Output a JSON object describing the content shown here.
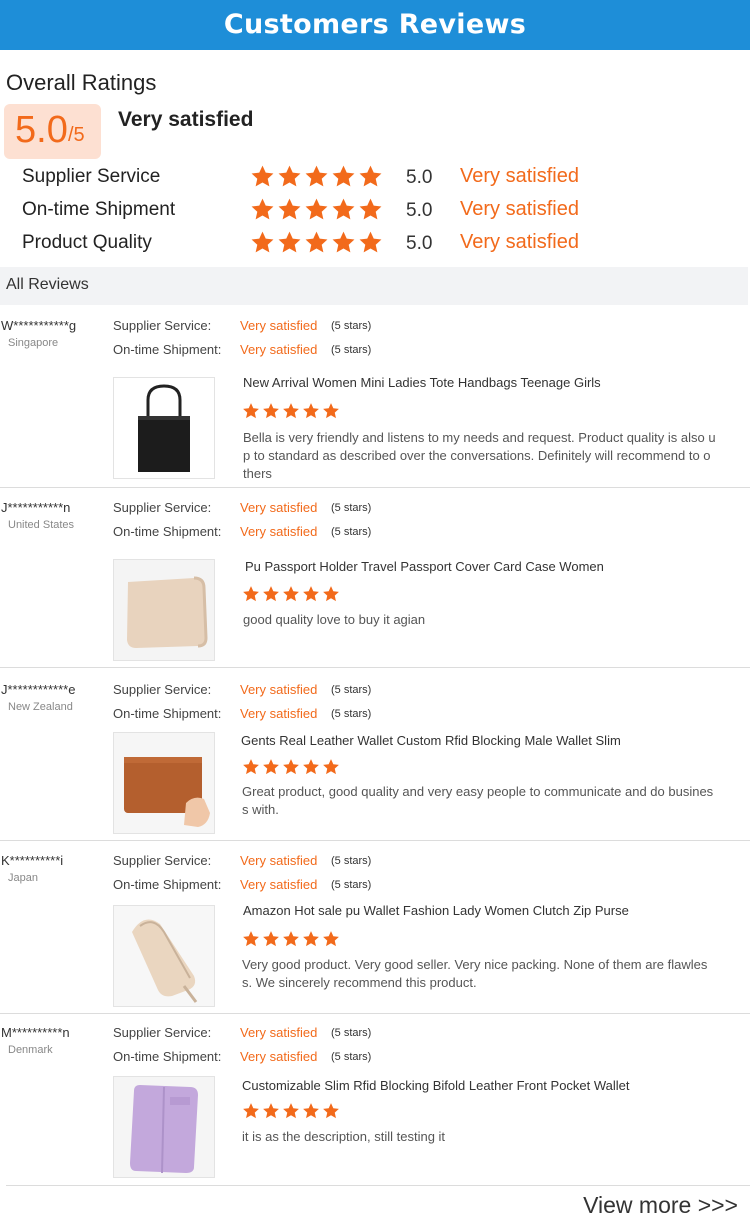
{
  "header": {
    "title": "Customers Reviews"
  },
  "overall": {
    "label": "Overall Ratings",
    "score": "5.0",
    "score_suffix": "/5",
    "text": "Very satisfied",
    "colors": {
      "accent": "#f26a1b",
      "score_bg": "#fde0d2",
      "banner": "#1e8ed8"
    }
  },
  "ratings": [
    {
      "label": "Supplier Service",
      "stars": 5,
      "score": "5.0",
      "text": "Very satisfied"
    },
    {
      "label": "On-time Shipment",
      "stars": 5,
      "score": "5.0",
      "text": "Very satisfied"
    },
    {
      "label": "Product Quality",
      "stars": 5,
      "score": "5.0",
      "text": "Very satisfied"
    }
  ],
  "all_reviews_label": "All Reviews",
  "reviews": [
    {
      "user": "W***********g",
      "country": "Singapore",
      "supplier_label": "Supplier Service:",
      "supplier_value": "Very satisfied",
      "supplier_stars": "(5 stars)",
      "shipment_label": "On-time Shipment:",
      "shipment_value": "Very satisfied",
      "shipment_stars": "(5 stars)",
      "product_title": "New Arrival Women Mini Ladies Tote Handbags Teenage Girls",
      "product_stars": 5,
      "product_image": "black-tote-bag",
      "comment_lines": [
        "Bella is very friendly and listens to my needs and request. Product quality is also u",
        "p to standard as described over the conversations. Definitely will recommend to o",
        "thers"
      ]
    },
    {
      "user": "J***********n",
      "country": "United States",
      "supplier_label": "Supplier Service:",
      "supplier_value": "Very satisfied",
      "supplier_stars": "(5 stars)",
      "shipment_label": "On-time Shipment:",
      "shipment_value": "Very satisfied",
      "shipment_stars": "(5 stars)",
      "product_title": "Pu Passport Holder Travel Passport Cover Card Case Women",
      "product_stars": 5,
      "product_image": "beige-card-case",
      "comment_lines": [
        "good quality love to buy it agian"
      ]
    },
    {
      "user": "J************e",
      "country": "New Zealand",
      "supplier_label": "Supplier Service:",
      "supplier_value": "Very satisfied",
      "supplier_stars": "(5 stars)",
      "shipment_label": "On-time Shipment:",
      "shipment_value": "Very satisfied",
      "shipment_stars": "(5 stars)",
      "product_title": "Gents Real Leather Wallet Custom Rfid Blocking Male Wallet Slim",
      "product_stars": 5,
      "product_image": "brown-leather-wallet",
      "comment_lines": [
        "Great product, good quality and very easy people to communicate and do busines",
        "s with."
      ]
    },
    {
      "user": "K**********i",
      "country": "Japan",
      "supplier_label": "Supplier Service:",
      "supplier_value": "Very satisfied",
      "supplier_stars": "(5 stars)",
      "shipment_label": "On-time Shipment:",
      "shipment_value": "Very satisfied",
      "shipment_stars": "(5 stars)",
      "product_title": "Amazon Hot sale pu Wallet Fashion Lady Women Clutch Zip Purse",
      "product_stars": 5,
      "product_image": "beige-zip-purse",
      "comment_lines": [
        "Very good product. Very good seller. Very nice packing. None of them are flawles",
        "s. We sincerely recommend this product."
      ]
    },
    {
      "user": "M**********n",
      "country": "Denmark",
      "supplier_label": "Supplier Service:",
      "supplier_value": "Very satisfied",
      "supplier_stars": "(5 stars)",
      "shipment_label": "On-time Shipment:",
      "shipment_value": "Very satisfied",
      "shipment_stars": "(5 stars)",
      "product_title": "Customizable Slim Rfid Blocking Bifold Leather Front Pocket Wallet",
      "product_stars": 5,
      "product_image": "lavender-bifold-wallet",
      "comment_lines": [
        "it is as the description, still testing it"
      ]
    }
  ],
  "view_more": "View more >>>"
}
